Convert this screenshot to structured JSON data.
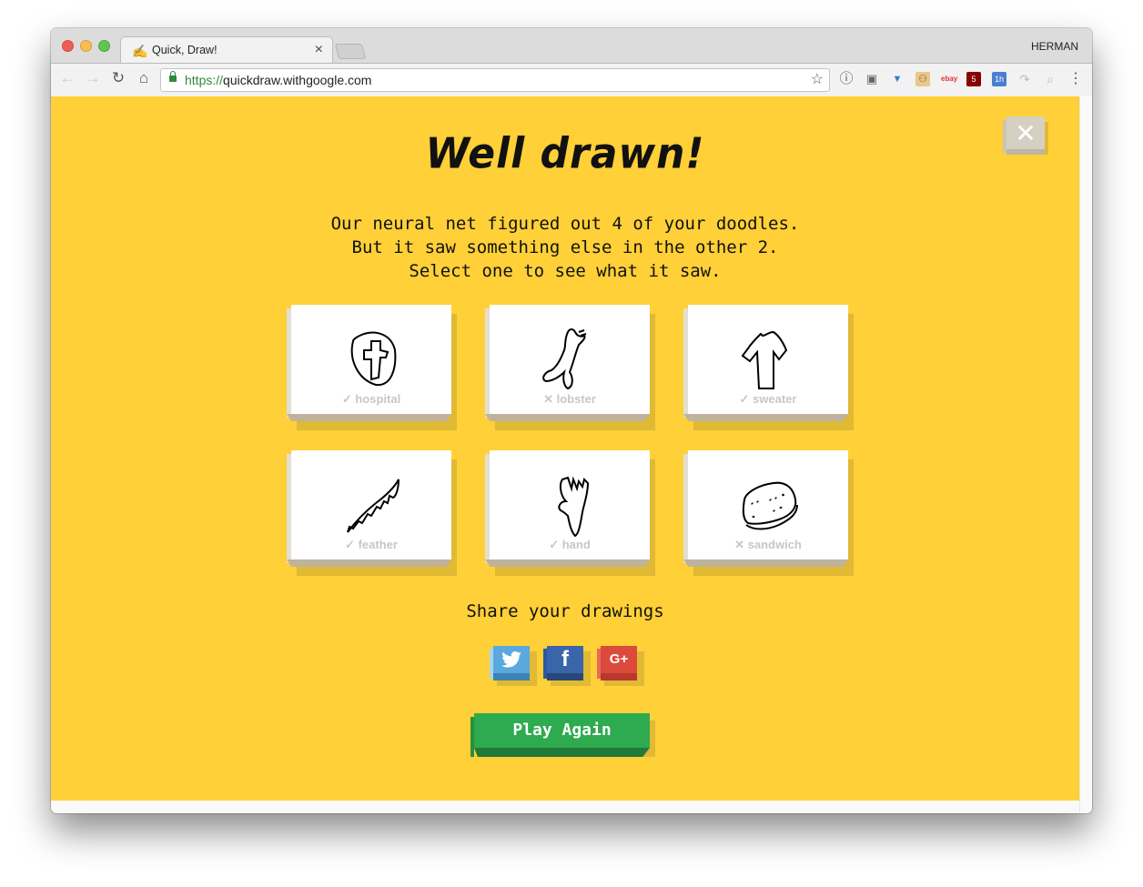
{
  "browser": {
    "tab_title": "Quick, Draw!",
    "tab_favicon": "✍",
    "profile_name": "HERMAN",
    "url_scheme": "https://",
    "url_host": "quickdraw.withgoogle.com",
    "extensions": [
      {
        "name": "1password-icon",
        "glyph": "ⓘ"
      },
      {
        "name": "copy-icon",
        "glyph": "▣"
      },
      {
        "name": "vee-icon",
        "glyph": "▼"
      },
      {
        "name": "plug-icon",
        "glyph": "⚇"
      },
      {
        "name": "ebay-icon",
        "glyph": "ebay"
      },
      {
        "name": "ublock-icon",
        "glyph": "5"
      },
      {
        "name": "calendar-icon",
        "glyph": "1h"
      },
      {
        "name": "redirect-icon",
        "glyph": "↷"
      },
      {
        "name": "inspect-icon",
        "glyph": "⌕"
      },
      {
        "name": "menu-icon",
        "glyph": "⋮"
      }
    ]
  },
  "page": {
    "heading": "Well drawn!",
    "close_glyph": "✕",
    "message_lines": [
      "Our neural net figured out 4 of your doodles.",
      "But it saw something else in the other 2.",
      "Select one to see what it saw."
    ],
    "drawings": [
      {
        "label": "hospital",
        "recognized": true,
        "mark": "✓"
      },
      {
        "label": "lobster",
        "recognized": false,
        "mark": "✕"
      },
      {
        "label": "sweater",
        "recognized": true,
        "mark": "✓"
      },
      {
        "label": "feather",
        "recognized": true,
        "mark": "✓"
      },
      {
        "label": "hand",
        "recognized": true,
        "mark": "✓"
      },
      {
        "label": "sandwich",
        "recognized": false,
        "mark": "✕"
      }
    ],
    "share_title": "Share your drawings",
    "social": [
      {
        "name": "twitter",
        "glyph": "🐦",
        "color": "#5aa9de",
        "side": "#a7d4f0",
        "bottom": "#3d82b3"
      },
      {
        "name": "facebook",
        "glyph": "f",
        "color": "#3a65a8",
        "side": "#2f56a0",
        "bottom": "#274879"
      },
      {
        "name": "google-plus",
        "glyph": "G+",
        "color": "#dc4a3c",
        "side": "#e8695c",
        "bottom": "#b8382d"
      }
    ],
    "play_again": "Play Again"
  },
  "colors": {
    "background": "#ffd037",
    "play_button": "#2eaa4f"
  }
}
